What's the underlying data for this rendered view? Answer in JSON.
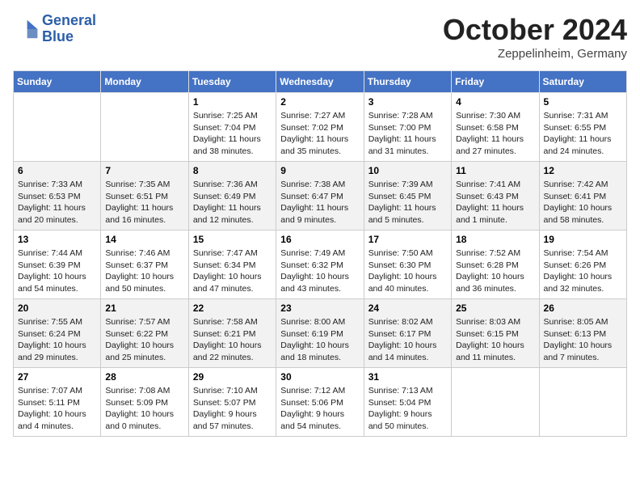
{
  "header": {
    "logo_line1": "General",
    "logo_line2": "Blue",
    "month": "October 2024",
    "location": "Zeppelinheim, Germany"
  },
  "days_of_week": [
    "Sunday",
    "Monday",
    "Tuesday",
    "Wednesday",
    "Thursday",
    "Friday",
    "Saturday"
  ],
  "weeks": [
    [
      {
        "day": "",
        "content": ""
      },
      {
        "day": "",
        "content": ""
      },
      {
        "day": "1",
        "content": "Sunrise: 7:25 AM\nSunset: 7:04 PM\nDaylight: 11 hours\nand 38 minutes."
      },
      {
        "day": "2",
        "content": "Sunrise: 7:27 AM\nSunset: 7:02 PM\nDaylight: 11 hours\nand 35 minutes."
      },
      {
        "day": "3",
        "content": "Sunrise: 7:28 AM\nSunset: 7:00 PM\nDaylight: 11 hours\nand 31 minutes."
      },
      {
        "day": "4",
        "content": "Sunrise: 7:30 AM\nSunset: 6:58 PM\nDaylight: 11 hours\nand 27 minutes."
      },
      {
        "day": "5",
        "content": "Sunrise: 7:31 AM\nSunset: 6:55 PM\nDaylight: 11 hours\nand 24 minutes."
      }
    ],
    [
      {
        "day": "6",
        "content": "Sunrise: 7:33 AM\nSunset: 6:53 PM\nDaylight: 11 hours\nand 20 minutes."
      },
      {
        "day": "7",
        "content": "Sunrise: 7:35 AM\nSunset: 6:51 PM\nDaylight: 11 hours\nand 16 minutes."
      },
      {
        "day": "8",
        "content": "Sunrise: 7:36 AM\nSunset: 6:49 PM\nDaylight: 11 hours\nand 12 minutes."
      },
      {
        "day": "9",
        "content": "Sunrise: 7:38 AM\nSunset: 6:47 PM\nDaylight: 11 hours\nand 9 minutes."
      },
      {
        "day": "10",
        "content": "Sunrise: 7:39 AM\nSunset: 6:45 PM\nDaylight: 11 hours\nand 5 minutes."
      },
      {
        "day": "11",
        "content": "Sunrise: 7:41 AM\nSunset: 6:43 PM\nDaylight: 11 hours\nand 1 minute."
      },
      {
        "day": "12",
        "content": "Sunrise: 7:42 AM\nSunset: 6:41 PM\nDaylight: 10 hours\nand 58 minutes."
      }
    ],
    [
      {
        "day": "13",
        "content": "Sunrise: 7:44 AM\nSunset: 6:39 PM\nDaylight: 10 hours\nand 54 minutes."
      },
      {
        "day": "14",
        "content": "Sunrise: 7:46 AM\nSunset: 6:37 PM\nDaylight: 10 hours\nand 50 minutes."
      },
      {
        "day": "15",
        "content": "Sunrise: 7:47 AM\nSunset: 6:34 PM\nDaylight: 10 hours\nand 47 minutes."
      },
      {
        "day": "16",
        "content": "Sunrise: 7:49 AM\nSunset: 6:32 PM\nDaylight: 10 hours\nand 43 minutes."
      },
      {
        "day": "17",
        "content": "Sunrise: 7:50 AM\nSunset: 6:30 PM\nDaylight: 10 hours\nand 40 minutes."
      },
      {
        "day": "18",
        "content": "Sunrise: 7:52 AM\nSunset: 6:28 PM\nDaylight: 10 hours\nand 36 minutes."
      },
      {
        "day": "19",
        "content": "Sunrise: 7:54 AM\nSunset: 6:26 PM\nDaylight: 10 hours\nand 32 minutes."
      }
    ],
    [
      {
        "day": "20",
        "content": "Sunrise: 7:55 AM\nSunset: 6:24 PM\nDaylight: 10 hours\nand 29 minutes."
      },
      {
        "day": "21",
        "content": "Sunrise: 7:57 AM\nSunset: 6:22 PM\nDaylight: 10 hours\nand 25 minutes."
      },
      {
        "day": "22",
        "content": "Sunrise: 7:58 AM\nSunset: 6:21 PM\nDaylight: 10 hours\nand 22 minutes."
      },
      {
        "day": "23",
        "content": "Sunrise: 8:00 AM\nSunset: 6:19 PM\nDaylight: 10 hours\nand 18 minutes."
      },
      {
        "day": "24",
        "content": "Sunrise: 8:02 AM\nSunset: 6:17 PM\nDaylight: 10 hours\nand 14 minutes."
      },
      {
        "day": "25",
        "content": "Sunrise: 8:03 AM\nSunset: 6:15 PM\nDaylight: 10 hours\nand 11 minutes."
      },
      {
        "day": "26",
        "content": "Sunrise: 8:05 AM\nSunset: 6:13 PM\nDaylight: 10 hours\nand 7 minutes."
      }
    ],
    [
      {
        "day": "27",
        "content": "Sunrise: 7:07 AM\nSunset: 5:11 PM\nDaylight: 10 hours\nand 4 minutes."
      },
      {
        "day": "28",
        "content": "Sunrise: 7:08 AM\nSunset: 5:09 PM\nDaylight: 10 hours\nand 0 minutes."
      },
      {
        "day": "29",
        "content": "Sunrise: 7:10 AM\nSunset: 5:07 PM\nDaylight: 9 hours\nand 57 minutes."
      },
      {
        "day": "30",
        "content": "Sunrise: 7:12 AM\nSunset: 5:06 PM\nDaylight: 9 hours\nand 54 minutes."
      },
      {
        "day": "31",
        "content": "Sunrise: 7:13 AM\nSunset: 5:04 PM\nDaylight: 9 hours\nand 50 minutes."
      },
      {
        "day": "",
        "content": ""
      },
      {
        "day": "",
        "content": ""
      }
    ]
  ]
}
